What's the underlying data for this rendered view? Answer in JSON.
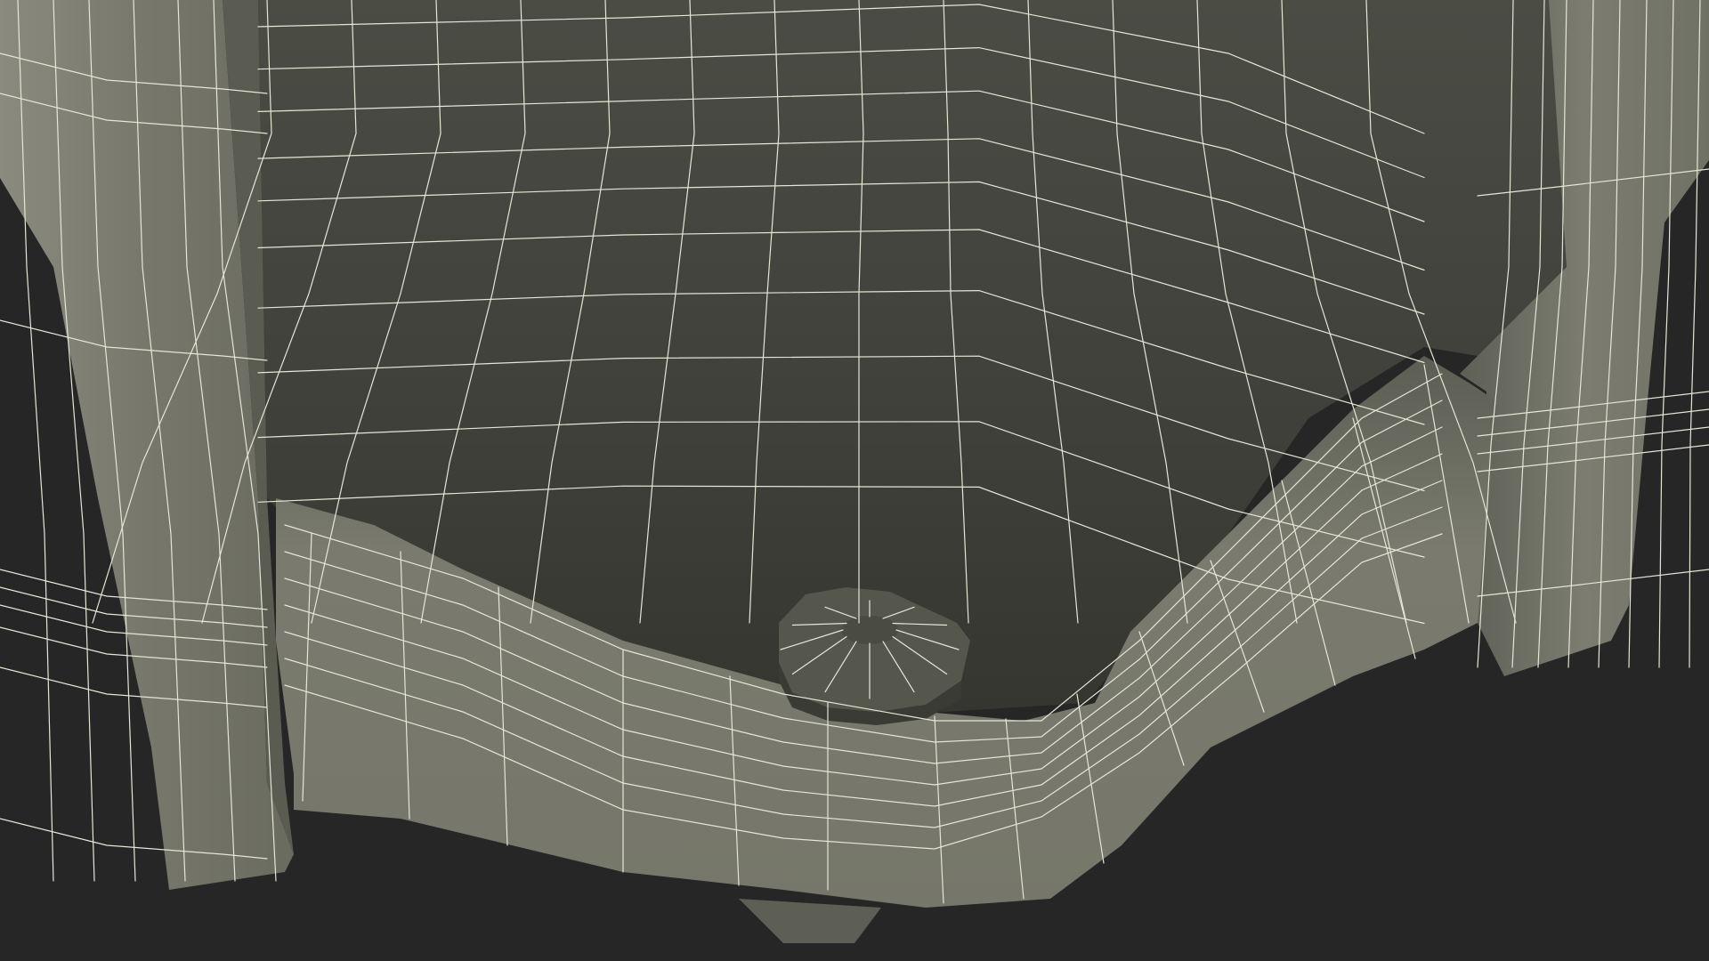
{
  "scene": {
    "subject": "urinal-wireframe-render",
    "background_color": "#262626",
    "body_color": "#77786b",
    "body_shadow_color": "#4a4b42",
    "bowl_interior_color": "#3e3f38",
    "wire_color": "#e6e6d6",
    "drain_color": "#55574d"
  }
}
